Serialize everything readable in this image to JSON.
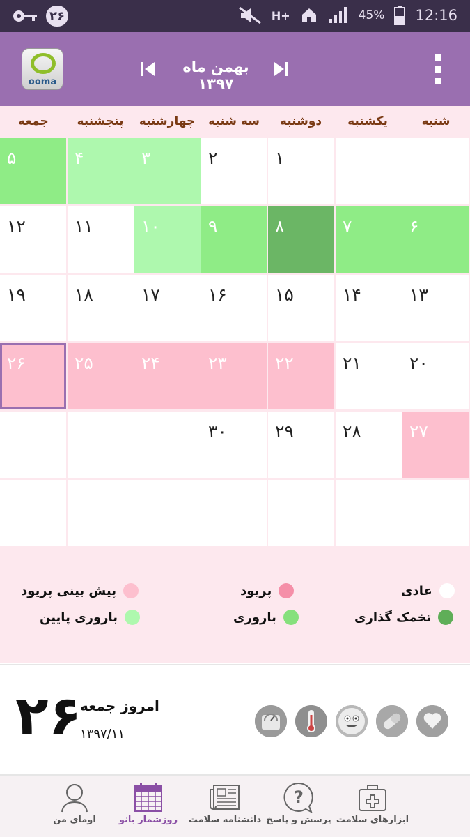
{
  "status": {
    "notif_count": "۲۶",
    "battery": "45%",
    "time": "12:16",
    "net": "H+"
  },
  "header": {
    "title": "بهمن ماه ۱۳۹۷",
    "logo_text": "ooma"
  },
  "weekdays": [
    "جمعه",
    "پنجشنبه",
    "چهارشنبه",
    "سه شنبه",
    "دوشنبه",
    "یکشنبه",
    "شنبه"
  ],
  "calendar": {
    "rows": [
      [
        {
          "d": "۵",
          "s": "green"
        },
        {
          "d": "۴",
          "s": "light-green"
        },
        {
          "d": "۳",
          "s": "light-green"
        },
        {
          "d": "۲",
          "s": "normal"
        },
        {
          "d": "۱",
          "s": "normal"
        },
        {
          "d": "",
          "s": "normal"
        },
        {
          "d": "",
          "s": "normal"
        }
      ],
      [
        {
          "d": "۱۲",
          "s": "normal"
        },
        {
          "d": "۱۱",
          "s": "normal"
        },
        {
          "d": "۱۰",
          "s": "light-green"
        },
        {
          "d": "۹",
          "s": "green"
        },
        {
          "d": "۸",
          "s": "dark-green"
        },
        {
          "d": "۷",
          "s": "green"
        },
        {
          "d": "۶",
          "s": "green"
        }
      ],
      [
        {
          "d": "۱۹",
          "s": "normal"
        },
        {
          "d": "۱۸",
          "s": "normal"
        },
        {
          "d": "۱۷",
          "s": "normal"
        },
        {
          "d": "۱۶",
          "s": "normal"
        },
        {
          "d": "۱۵",
          "s": "normal"
        },
        {
          "d": "۱۴",
          "s": "normal"
        },
        {
          "d": "۱۳",
          "s": "normal"
        }
      ],
      [
        {
          "d": "۲۶",
          "s": "pink",
          "today": true
        },
        {
          "d": "۲۵",
          "s": "pink"
        },
        {
          "d": "۲۴",
          "s": "pink"
        },
        {
          "d": "۲۳",
          "s": "pink"
        },
        {
          "d": "۲۲",
          "s": "pink"
        },
        {
          "d": "۲۱",
          "s": "normal"
        },
        {
          "d": "۲۰",
          "s": "normal"
        }
      ],
      [
        {
          "d": "",
          "s": "normal"
        },
        {
          "d": "",
          "s": "normal"
        },
        {
          "d": "",
          "s": "normal"
        },
        {
          "d": "۳۰",
          "s": "normal"
        },
        {
          "d": "۲۹",
          "s": "normal"
        },
        {
          "d": "۲۸",
          "s": "normal"
        },
        {
          "d": "۲۷",
          "s": "pink"
        }
      ],
      [
        {
          "d": "",
          "s": "normal"
        },
        {
          "d": "",
          "s": "normal"
        },
        {
          "d": "",
          "s": "normal"
        },
        {
          "d": "",
          "s": "normal"
        },
        {
          "d": "",
          "s": "normal"
        },
        {
          "d": "",
          "s": "normal"
        },
        {
          "d": "",
          "s": "normal"
        }
      ]
    ]
  },
  "legend": {
    "predicted_period": "پیش بینی پریود",
    "period": "پریود",
    "normal": "عادی",
    "low_fertility": "باروری پایین",
    "fertility": "باروری",
    "ovulation": "تخمک گذاری",
    "colors": {
      "predicted_period": "#fdbfce",
      "period": "#f58fa8",
      "normal": "#ffffff",
      "low_fertility": "#aef8ae",
      "fertility": "#86e07c",
      "ovulation": "#5fae58"
    }
  },
  "today": {
    "day": "۲۶",
    "label": "امروز جمعه",
    "date": "۱۳۹۷/۱۱"
  },
  "tools": [
    "scale-icon",
    "thermometer-icon",
    "mood-icon",
    "pill-icon",
    "heart-icon"
  ],
  "nav": [
    {
      "label": "اومای من",
      "icon": "profile-icon"
    },
    {
      "label": "روزشمار بانو",
      "icon": "calendar-icon",
      "active": true
    },
    {
      "label": "دانشنامه سلامت",
      "icon": "newspaper-icon"
    },
    {
      "label": "پرسش و پاسخ",
      "icon": "question-icon"
    },
    {
      "label": "ابزارهای سلامت",
      "icon": "medkit-icon"
    }
  ]
}
